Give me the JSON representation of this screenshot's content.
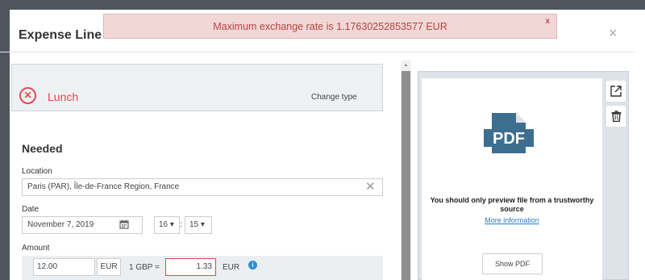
{
  "modal": {
    "title": "Expense Line #1",
    "close_glyph": "×"
  },
  "alert": {
    "message": "Maximum exchange rate is 1.17630252853577 EUR",
    "close_glyph": "x"
  },
  "expense_type": {
    "icon": "restaurant-icon",
    "label": "Lunch",
    "change_label": "Change type",
    "color": "#e04848"
  },
  "form": {
    "section_title": "Needed",
    "location": {
      "label": "Location",
      "value": "Paris (PAR), Île-de-France Region, France",
      "clear_glyph": "✕"
    },
    "date": {
      "label": "Date",
      "value": "November 7, 2019",
      "hour": "16 ▾",
      "minute": "15 ▾",
      "separator": ":"
    },
    "amount": {
      "label": "Amount",
      "value": "12.00",
      "currency": "EUR",
      "fx_label": "1 GBP =",
      "fx_value": "1.33",
      "fx_currency": "EUR",
      "info_glyph": "i"
    }
  },
  "preview": {
    "file_type": "PDF",
    "warning": "You should only preview file from a trustworthy source",
    "more_info_label": "More information",
    "show_button_label": "Show PDF",
    "open_external_icon": "open-external-icon",
    "delete_icon": "trash-icon",
    "accent_color": "#3d6e8f"
  },
  "scrollbar": {
    "up_glyph": "▲"
  }
}
